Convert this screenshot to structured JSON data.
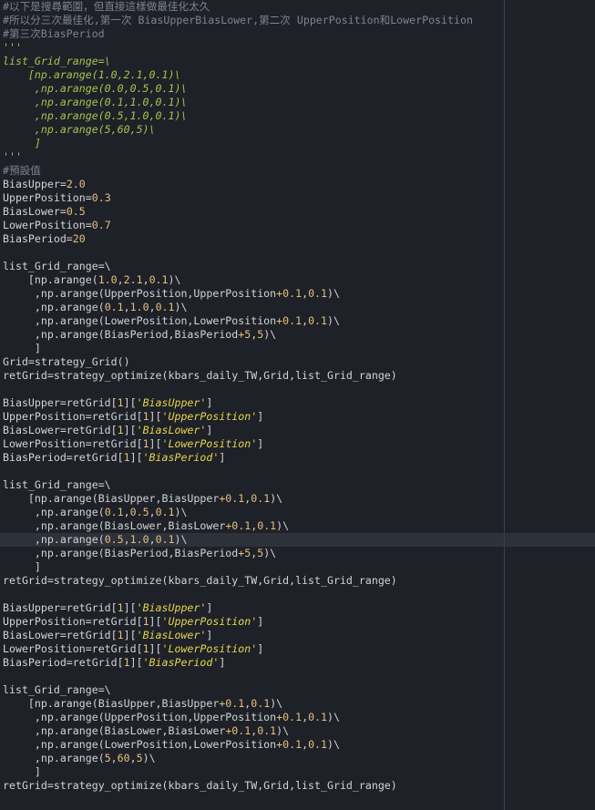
{
  "editor": {
    "lines": [
      {
        "segments": [
          {
            "k": "c",
            "t": "#以下是搜尋範圍，但直接這樣做最佳化太久"
          }
        ]
      },
      {
        "segments": [
          {
            "k": "c",
            "t": "#所以分三次最佳化,第一次 BiasUpperBiasLower,第二次 UpperPosition和LowerPosition"
          }
        ]
      },
      {
        "segments": [
          {
            "k": "c",
            "t": "#第三次BiasPeriod"
          }
        ]
      },
      {
        "segments": [
          {
            "k": "d",
            "t": "'''"
          }
        ]
      },
      {
        "segments": [
          {
            "k": "d",
            "t": "list_Grid_range=\\"
          }
        ]
      },
      {
        "segments": [
          {
            "k": "d",
            "t": "    [np.arange(1.0,2.1,0.1)\\"
          }
        ]
      },
      {
        "segments": [
          {
            "k": "d",
            "t": "     ,np.arange(0.0,0.5,0.1)\\"
          }
        ]
      },
      {
        "segments": [
          {
            "k": "d",
            "t": "     ,np.arange(0.1,1.0,0.1)\\"
          }
        ]
      },
      {
        "segments": [
          {
            "k": "d",
            "t": "     ,np.arange(0.5,1.0,0.1)\\"
          }
        ]
      },
      {
        "segments": [
          {
            "k": "d",
            "t": "     ,np.arange(5,60,5)\\"
          }
        ]
      },
      {
        "segments": [
          {
            "k": "d",
            "t": "     ]"
          }
        ]
      },
      {
        "segments": [
          {
            "k": "d",
            "t": "'''"
          }
        ]
      },
      {
        "segments": [
          {
            "k": "c",
            "t": "#預設值"
          }
        ]
      },
      {
        "segments": [
          {
            "k": "t",
            "t": "BiasUpper="
          },
          {
            "k": "n",
            "t": "2.0"
          }
        ]
      },
      {
        "segments": [
          {
            "k": "t",
            "t": "UpperPosition="
          },
          {
            "k": "n",
            "t": "0.3"
          }
        ]
      },
      {
        "segments": [
          {
            "k": "t",
            "t": "BiasLower="
          },
          {
            "k": "n",
            "t": "0.5"
          }
        ]
      },
      {
        "segments": [
          {
            "k": "t",
            "t": "LowerPosition="
          },
          {
            "k": "n",
            "t": "0.7"
          }
        ]
      },
      {
        "segments": [
          {
            "k": "t",
            "t": "BiasPeriod="
          },
          {
            "k": "n",
            "t": "20"
          }
        ]
      },
      {
        "segments": []
      },
      {
        "segments": [
          {
            "k": "t",
            "t": "list_Grid_range=\\"
          }
        ]
      },
      {
        "segments": [
          {
            "k": "t",
            "t": "    [np.arange("
          },
          {
            "k": "n",
            "t": "1.0"
          },
          {
            "k": "t",
            "t": ","
          },
          {
            "k": "n",
            "t": "2.1"
          },
          {
            "k": "t",
            "t": ","
          },
          {
            "k": "n",
            "t": "0.1"
          },
          {
            "k": "t",
            "t": ")\\"
          }
        ]
      },
      {
        "segments": [
          {
            "k": "t",
            "t": "     ,np.arange(UpperPosition,UpperPosition"
          },
          {
            "k": "o",
            "t": "+0.1"
          },
          {
            "k": "t",
            "t": ","
          },
          {
            "k": "n",
            "t": "0.1"
          },
          {
            "k": "t",
            "t": ")\\"
          }
        ]
      },
      {
        "segments": [
          {
            "k": "t",
            "t": "     ,np.arange("
          },
          {
            "k": "n",
            "t": "0.1"
          },
          {
            "k": "t",
            "t": ","
          },
          {
            "k": "n",
            "t": "1.0"
          },
          {
            "k": "t",
            "t": ","
          },
          {
            "k": "n",
            "t": "0.1"
          },
          {
            "k": "t",
            "t": ")\\"
          }
        ]
      },
      {
        "segments": [
          {
            "k": "t",
            "t": "     ,np.arange(LowerPosition,LowerPosition"
          },
          {
            "k": "o",
            "t": "+0.1"
          },
          {
            "k": "t",
            "t": ","
          },
          {
            "k": "n",
            "t": "0.1"
          },
          {
            "k": "t",
            "t": ")\\"
          }
        ]
      },
      {
        "segments": [
          {
            "k": "t",
            "t": "     ,np.arange(BiasPeriod,BiasPeriod"
          },
          {
            "k": "o",
            "t": "+5"
          },
          {
            "k": "t",
            "t": ","
          },
          {
            "k": "n",
            "t": "5"
          },
          {
            "k": "t",
            "t": ")\\"
          }
        ]
      },
      {
        "segments": [
          {
            "k": "t",
            "t": "     ]"
          }
        ]
      },
      {
        "segments": [
          {
            "k": "t",
            "t": "Grid=strategy_Grid()"
          }
        ]
      },
      {
        "segments": [
          {
            "k": "t",
            "t": "retGrid=strategy_optimize(kbars_daily_TW,Grid,list_Grid_range)"
          }
        ]
      },
      {
        "segments": []
      },
      {
        "segments": [
          {
            "k": "t",
            "t": "BiasUpper=retGrid["
          },
          {
            "k": "n",
            "t": "1"
          },
          {
            "k": "t",
            "t": "]["
          },
          {
            "k": "s",
            "t": "'BiasUpper'"
          },
          {
            "k": "t",
            "t": "]"
          }
        ]
      },
      {
        "segments": [
          {
            "k": "t",
            "t": "UpperPosition=retGrid["
          },
          {
            "k": "n",
            "t": "1"
          },
          {
            "k": "t",
            "t": "]["
          },
          {
            "k": "s",
            "t": "'UpperPosition'"
          },
          {
            "k": "t",
            "t": "]"
          }
        ]
      },
      {
        "segments": [
          {
            "k": "t",
            "t": "BiasLower=retGrid["
          },
          {
            "k": "n",
            "t": "1"
          },
          {
            "k": "t",
            "t": "]["
          },
          {
            "k": "s",
            "t": "'BiasLower'"
          },
          {
            "k": "t",
            "t": "]"
          }
        ]
      },
      {
        "segments": [
          {
            "k": "t",
            "t": "LowerPosition=retGrid["
          },
          {
            "k": "n",
            "t": "1"
          },
          {
            "k": "t",
            "t": "]["
          },
          {
            "k": "s",
            "t": "'LowerPosition'"
          },
          {
            "k": "t",
            "t": "]"
          }
        ]
      },
      {
        "segments": [
          {
            "k": "t",
            "t": "BiasPeriod=retGrid["
          },
          {
            "k": "n",
            "t": "1"
          },
          {
            "k": "t",
            "t": "]["
          },
          {
            "k": "s",
            "t": "'BiasPeriod'"
          },
          {
            "k": "t",
            "t": "]"
          }
        ]
      },
      {
        "segments": []
      },
      {
        "segments": [
          {
            "k": "t",
            "t": "list_Grid_range=\\"
          }
        ]
      },
      {
        "segments": [
          {
            "k": "t",
            "t": "    [np.arange(BiasUpper,BiasUpper"
          },
          {
            "k": "o",
            "t": "+0.1"
          },
          {
            "k": "t",
            "t": ","
          },
          {
            "k": "n",
            "t": "0.1"
          },
          {
            "k": "t",
            "t": ")\\"
          }
        ]
      },
      {
        "segments": [
          {
            "k": "t",
            "t": "     ,np.arange("
          },
          {
            "k": "n",
            "t": "0.1"
          },
          {
            "k": "t",
            "t": ","
          },
          {
            "k": "n",
            "t": "0.5"
          },
          {
            "k": "t",
            "t": ","
          },
          {
            "k": "n",
            "t": "0.1"
          },
          {
            "k": "t",
            "t": ")\\"
          }
        ]
      },
      {
        "segments": [
          {
            "k": "t",
            "t": "     ,np.arange(BiasLower,BiasLower"
          },
          {
            "k": "o",
            "t": "+0.1"
          },
          {
            "k": "t",
            "t": ","
          },
          {
            "k": "n",
            "t": "0.1"
          },
          {
            "k": "t",
            "t": ")\\"
          }
        ]
      },
      {
        "highlight": true,
        "segments": [
          {
            "k": "t",
            "t": "     ,np.arange("
          },
          {
            "k": "n",
            "t": "0.5"
          },
          {
            "k": "t",
            "t": ","
          },
          {
            "k": "n",
            "t": "1.0"
          },
          {
            "k": "t",
            "t": ","
          },
          {
            "k": "n",
            "t": "0.1"
          },
          {
            "k": "t",
            "t": ")\\"
          }
        ]
      },
      {
        "segments": [
          {
            "k": "t",
            "t": "     ,np.arange(BiasPeriod,BiasPeriod"
          },
          {
            "k": "o",
            "t": "+5"
          },
          {
            "k": "t",
            "t": ","
          },
          {
            "k": "n",
            "t": "5"
          },
          {
            "k": "t",
            "t": ")\\"
          }
        ]
      },
      {
        "segments": [
          {
            "k": "t",
            "t": "     ]"
          }
        ]
      },
      {
        "segments": [
          {
            "k": "t",
            "t": "retGrid=strategy_optimize(kbars_daily_TW,Grid,list_Grid_range)"
          }
        ]
      },
      {
        "segments": []
      },
      {
        "segments": [
          {
            "k": "t",
            "t": "BiasUpper=retGrid["
          },
          {
            "k": "n",
            "t": "1"
          },
          {
            "k": "t",
            "t": "]["
          },
          {
            "k": "s",
            "t": "'BiasUpper'"
          },
          {
            "k": "t",
            "t": "]"
          }
        ]
      },
      {
        "segments": [
          {
            "k": "t",
            "t": "UpperPosition=retGrid["
          },
          {
            "k": "n",
            "t": "1"
          },
          {
            "k": "t",
            "t": "]["
          },
          {
            "k": "s",
            "t": "'UpperPosition'"
          },
          {
            "k": "t",
            "t": "]"
          }
        ]
      },
      {
        "segments": [
          {
            "k": "t",
            "t": "BiasLower=retGrid["
          },
          {
            "k": "n",
            "t": "1"
          },
          {
            "k": "t",
            "t": "]["
          },
          {
            "k": "s",
            "t": "'BiasLower'"
          },
          {
            "k": "t",
            "t": "]"
          }
        ]
      },
      {
        "segments": [
          {
            "k": "t",
            "t": "LowerPosition=retGrid["
          },
          {
            "k": "n",
            "t": "1"
          },
          {
            "k": "t",
            "t": "]["
          },
          {
            "k": "s",
            "t": "'LowerPosition'"
          },
          {
            "k": "t",
            "t": "]"
          }
        ]
      },
      {
        "segments": [
          {
            "k": "t",
            "t": "BiasPeriod=retGrid["
          },
          {
            "k": "n",
            "t": "1"
          },
          {
            "k": "t",
            "t": "]["
          },
          {
            "k": "s",
            "t": "'BiasPeriod'"
          },
          {
            "k": "t",
            "t": "]"
          }
        ]
      },
      {
        "segments": []
      },
      {
        "segments": [
          {
            "k": "t",
            "t": "list_Grid_range=\\"
          }
        ]
      },
      {
        "segments": [
          {
            "k": "t",
            "t": "    [np.arange(BiasUpper,BiasUpper"
          },
          {
            "k": "o",
            "t": "+0.1"
          },
          {
            "k": "t",
            "t": ","
          },
          {
            "k": "n",
            "t": "0.1"
          },
          {
            "k": "t",
            "t": ")\\"
          }
        ]
      },
      {
        "segments": [
          {
            "k": "t",
            "t": "     ,np.arange(UpperPosition,UpperPosition"
          },
          {
            "k": "o",
            "t": "+0.1"
          },
          {
            "k": "t",
            "t": ","
          },
          {
            "k": "n",
            "t": "0.1"
          },
          {
            "k": "t",
            "t": ")\\"
          }
        ]
      },
      {
        "segments": [
          {
            "k": "t",
            "t": "     ,np.arange(BiasLower,BiasLower"
          },
          {
            "k": "o",
            "t": "+0.1"
          },
          {
            "k": "t",
            "t": ","
          },
          {
            "k": "n",
            "t": "0.1"
          },
          {
            "k": "t",
            "t": ")\\"
          }
        ]
      },
      {
        "segments": [
          {
            "k": "t",
            "t": "     ,np.arange(LowerPosition,LowerPosition"
          },
          {
            "k": "o",
            "t": "+0.1"
          },
          {
            "k": "t",
            "t": ","
          },
          {
            "k": "n",
            "t": "0.1"
          },
          {
            "k": "t",
            "t": ")\\"
          }
        ]
      },
      {
        "segments": [
          {
            "k": "t",
            "t": "     ,np.arange("
          },
          {
            "k": "n",
            "t": "5"
          },
          {
            "k": "t",
            "t": ","
          },
          {
            "k": "n",
            "t": "60"
          },
          {
            "k": "t",
            "t": ","
          },
          {
            "k": "n",
            "t": "5"
          },
          {
            "k": "t",
            "t": ")\\"
          }
        ]
      },
      {
        "segments": [
          {
            "k": "t",
            "t": "     ]"
          }
        ]
      },
      {
        "segments": [
          {
            "k": "t",
            "t": "retGrid=strategy_optimize(kbars_daily_TW,Grid,list_Grid_range)"
          }
        ]
      }
    ]
  }
}
